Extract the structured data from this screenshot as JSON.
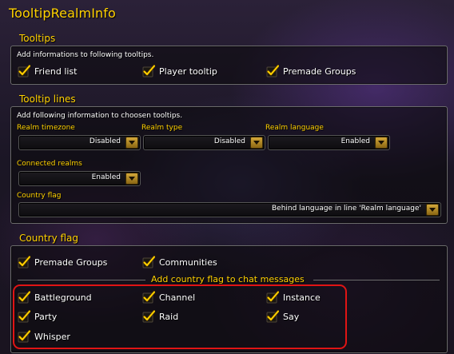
{
  "app_title": "TooltipRealmInfo",
  "tooltips": {
    "title": "Tooltips",
    "description": "Add informations to following tooltips.",
    "options": [
      "Friend list",
      "Player tooltip",
      "Premade Groups"
    ]
  },
  "tooltip_lines": {
    "title": "Tooltip lines",
    "description": "Add following information to choosen tooltips.",
    "realm_timezone": {
      "label": "Realm timezone",
      "value": "Disabled"
    },
    "realm_type": {
      "label": "Realm type",
      "value": "Disabled"
    },
    "realm_language": {
      "label": "Realm language",
      "value": "Enabled"
    },
    "connected_realms": {
      "label": "Connected realms",
      "value": "Enabled"
    },
    "country_flag": {
      "label": "Country flag",
      "value": "Behind language in line 'Realm language'"
    }
  },
  "country_flag": {
    "title": "Country flag",
    "options": [
      "Premade Groups",
      "Communities"
    ],
    "chat_heading": "Add country flag to chat messages",
    "chat_options": [
      "Battleground",
      "Channel",
      "Instance",
      "Party",
      "Raid",
      "Say",
      "Whisper"
    ]
  }
}
